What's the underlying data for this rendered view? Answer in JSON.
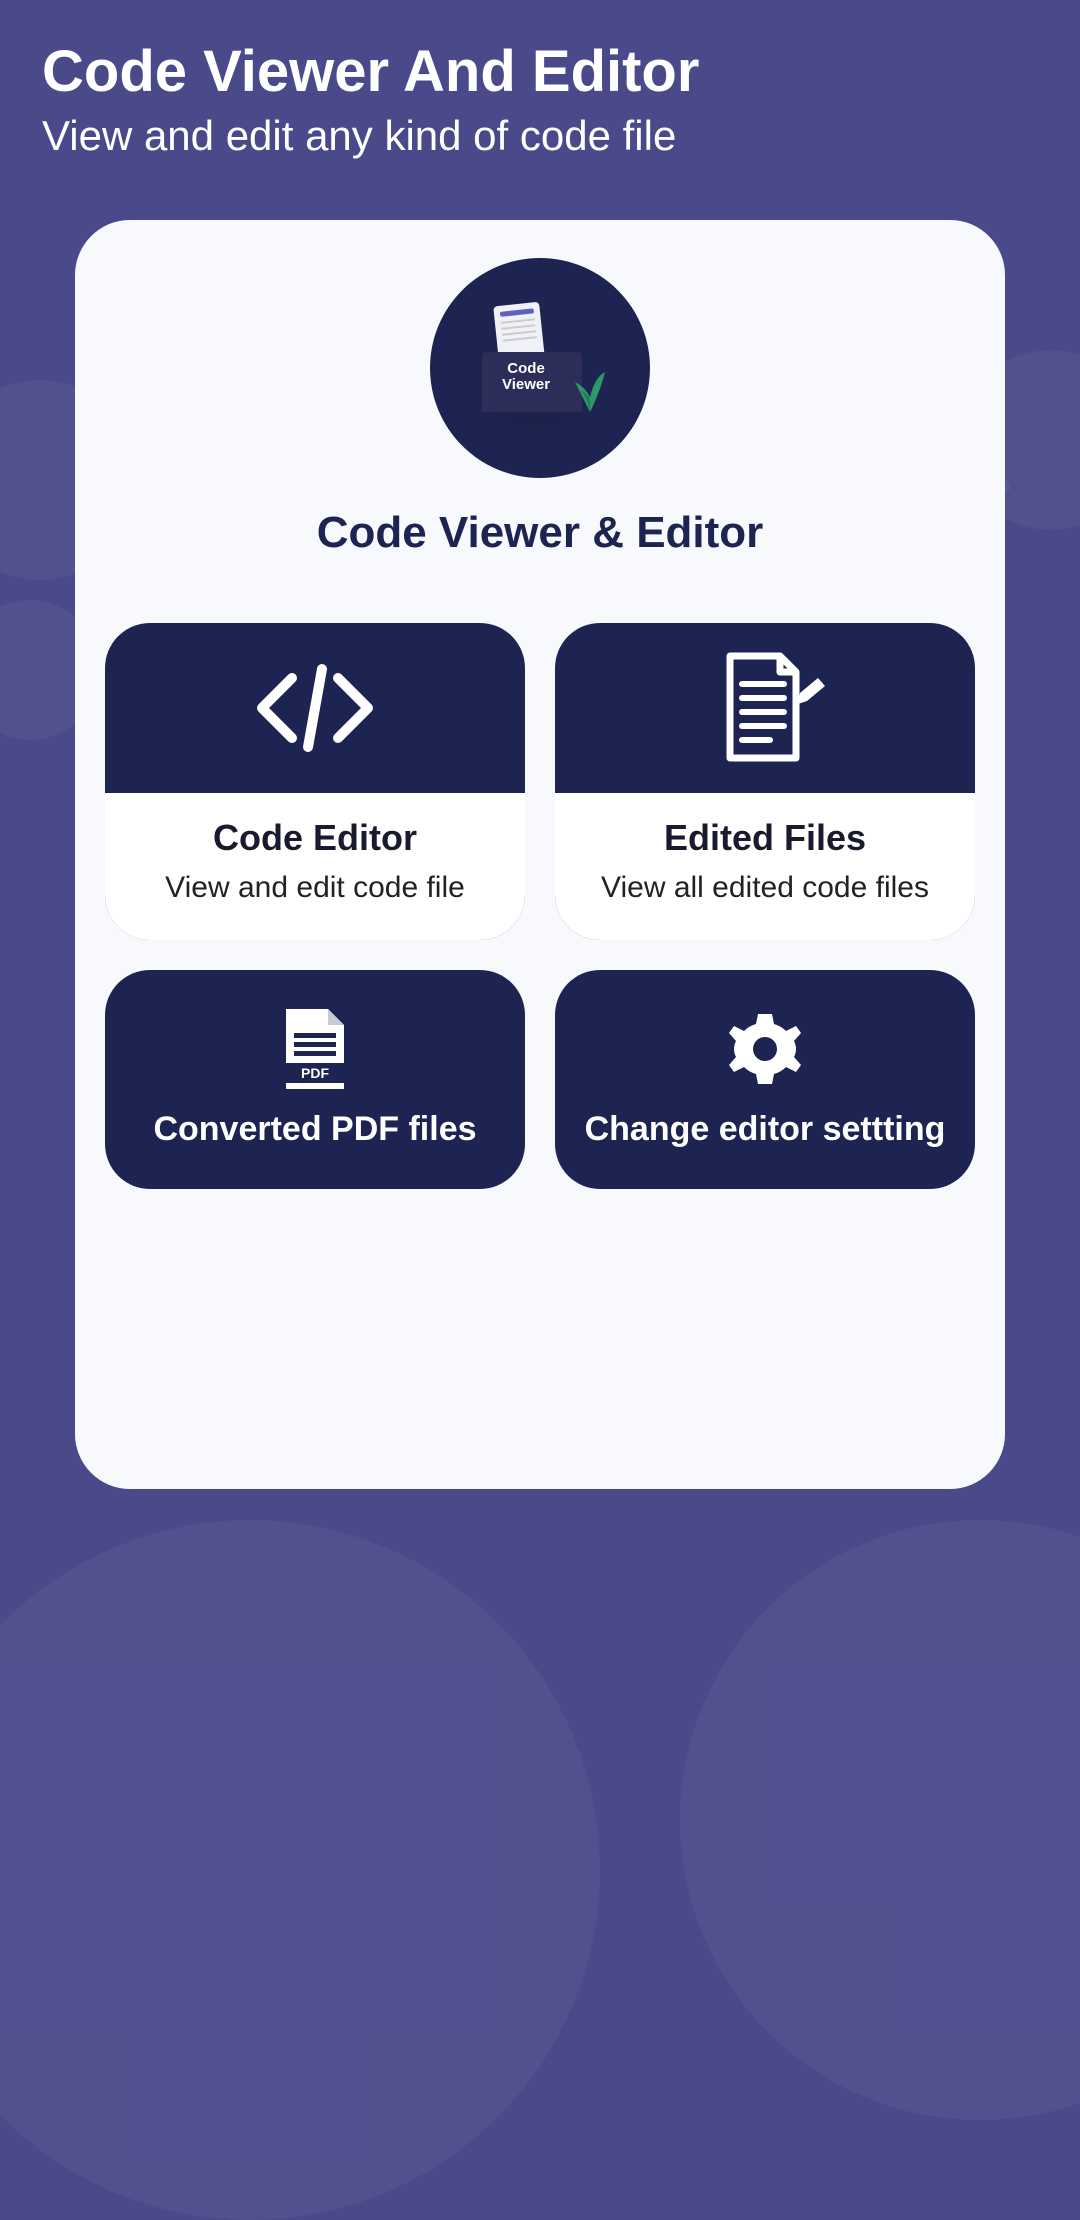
{
  "header": {
    "title": "Code Viewer And Editor",
    "subtitle": "View and edit any kind of code file"
  },
  "app": {
    "logo_badge_line1": "Code",
    "logo_badge_line2": "Viewer",
    "name": "Code Viewer & Editor"
  },
  "tiles": {
    "code_editor": {
      "title": "Code Editor",
      "desc": "View and edit code file"
    },
    "edited_files": {
      "title": "Edited Files",
      "desc": "View all edited code files"
    },
    "converted_pdf": {
      "title": "Converted PDF files",
      "badge": "PDF"
    },
    "settings": {
      "title": "Change editor settting"
    }
  }
}
